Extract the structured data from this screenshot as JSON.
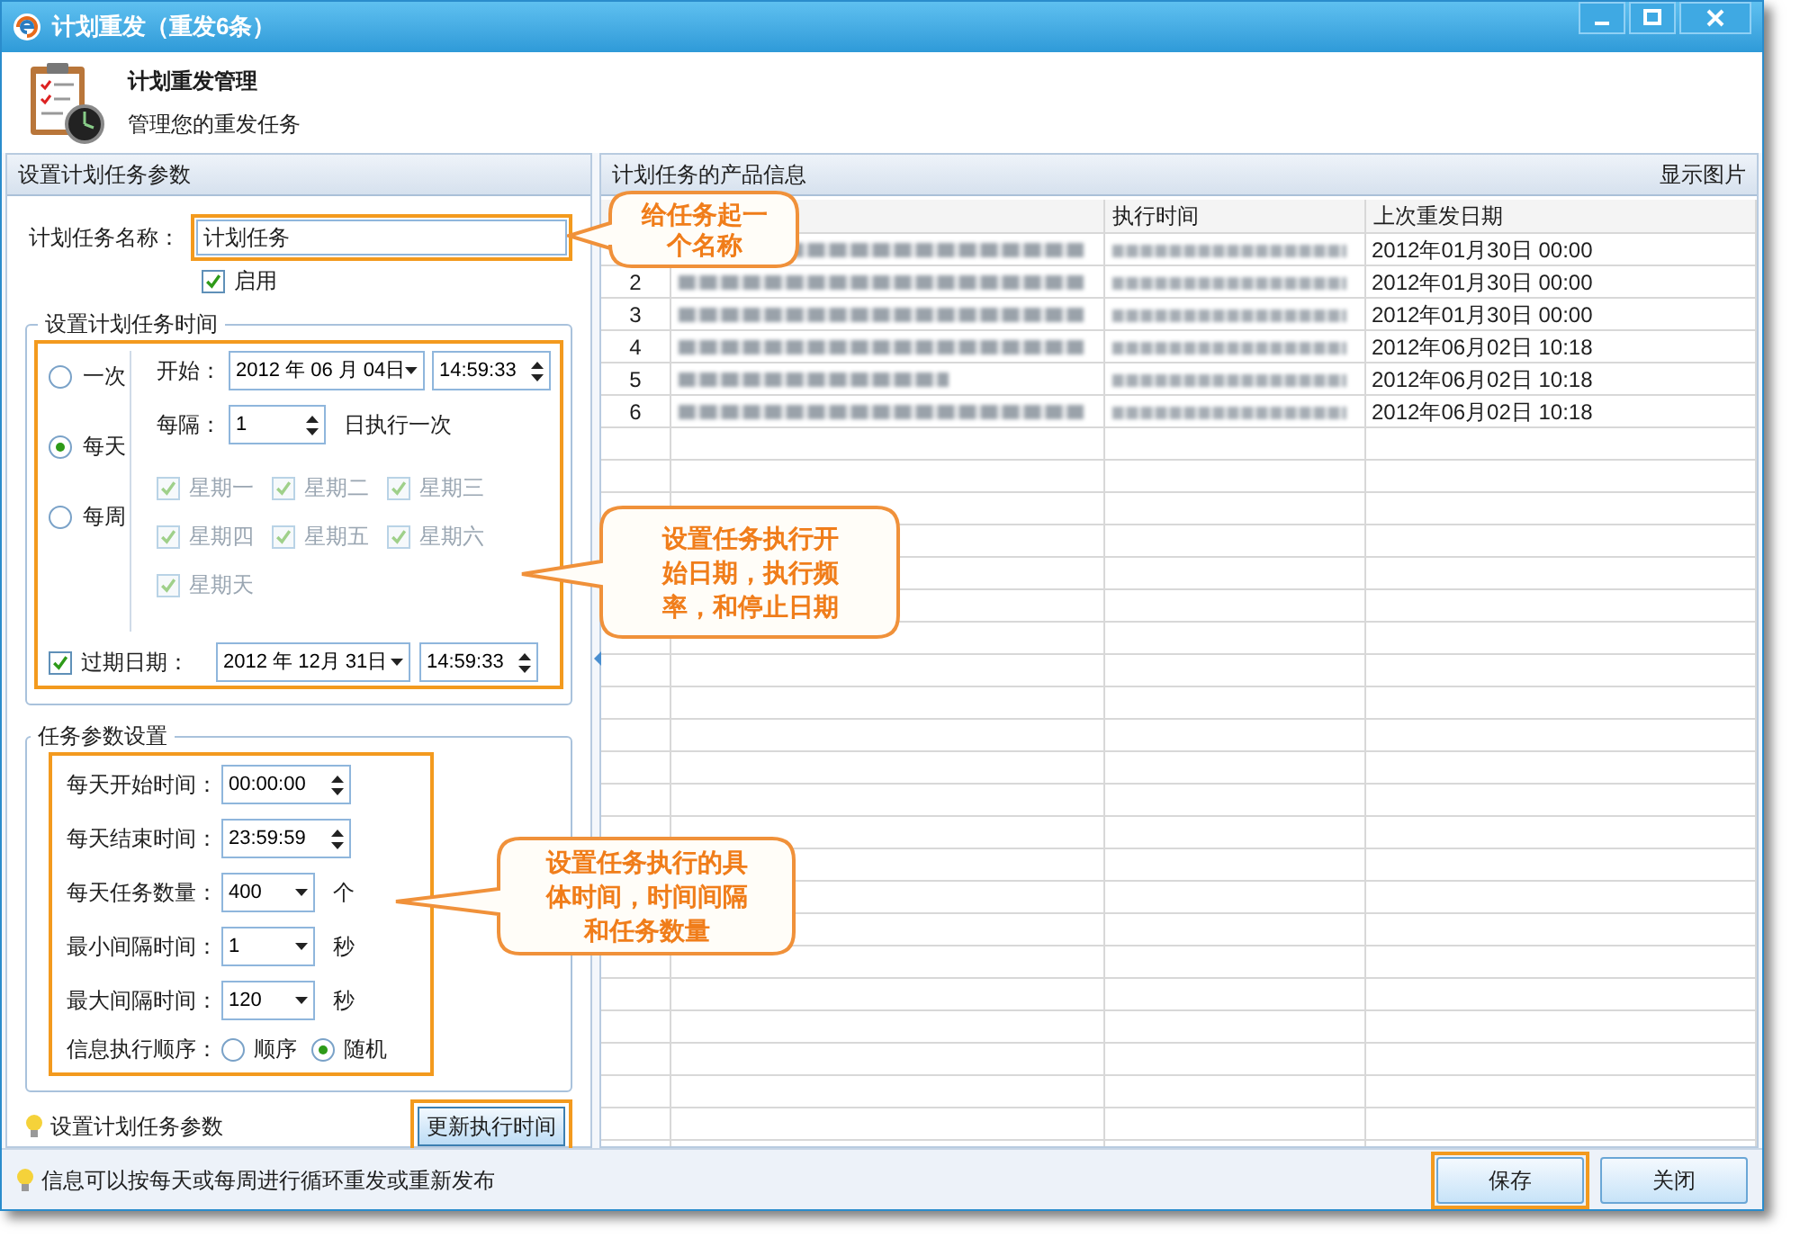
{
  "window": {
    "title": "计划重发（重发6条）"
  },
  "header": {
    "title": "计划重发管理",
    "subtitle": "管理您的重发任务"
  },
  "left_panel": {
    "title": "设置计划任务参数",
    "task_name": {
      "label": "计划任务名称：",
      "value": "计划任务"
    },
    "enable": {
      "label": "启用",
      "checked": true
    },
    "schedule": {
      "title": "设置计划任务时间",
      "modes": [
        {
          "label": "一次",
          "selected": false
        },
        {
          "label": "每天",
          "selected": true
        },
        {
          "label": "每周",
          "selected": false
        }
      ],
      "start": {
        "label": "开始：",
        "date": "2012 年 06 月 04日",
        "time": "14:59:33"
      },
      "interval": {
        "label": "每隔：",
        "value": "1",
        "suffix": "日执行一次"
      },
      "weekdays": [
        {
          "label": "星期一",
          "checked": true,
          "disabled": true
        },
        {
          "label": "星期二",
          "checked": true,
          "disabled": true
        },
        {
          "label": "星期三",
          "checked": true,
          "disabled": true
        },
        {
          "label": "星期四",
          "checked": true,
          "disabled": true
        },
        {
          "label": "星期五",
          "checked": true,
          "disabled": true
        },
        {
          "label": "星期六",
          "checked": true,
          "disabled": true
        },
        {
          "label": "星期天",
          "checked": true,
          "disabled": true
        }
      ],
      "expiry": {
        "label": "过期日期：",
        "checked": true,
        "date": "2012 年 12月 31日",
        "time": "14:59:33"
      }
    },
    "params": {
      "title": "任务参数设置",
      "rows": [
        {
          "kind": "spin",
          "label": "每天开始时间：",
          "value": "00:00:00"
        },
        {
          "kind": "spin",
          "label": "每天结束时间：",
          "value": "23:59:59"
        },
        {
          "kind": "combo",
          "label": "每天任务数量：",
          "value": "400",
          "unit": "个"
        },
        {
          "kind": "combo",
          "label": "最小间隔时间：",
          "value": "1",
          "unit": "秒"
        },
        {
          "kind": "combo",
          "label": "最大间隔时间：",
          "value": "120",
          "unit": "秒"
        }
      ],
      "order": {
        "label": "信息执行顺序：",
        "options": [
          {
            "label": "顺序",
            "selected": false
          },
          {
            "label": "随机",
            "selected": true
          }
        ]
      }
    },
    "hint": "设置计划任务参数",
    "update_button": "更新执行时间"
  },
  "right_panel": {
    "title": "计划任务的产品信息",
    "show_images": "显示图片",
    "table": {
      "columns": [
        "执行时间",
        "上次重发日期"
      ],
      "rows": [
        {
          "last_date": "2012年01月30日 00:00"
        },
        {
          "number": "2",
          "last_date": "2012年01月30日 00:00"
        },
        {
          "number": "3",
          "last_date": "2012年01月30日 00:00"
        },
        {
          "number": "4",
          "last_date": "2012年06月02日 10:18"
        },
        {
          "number": "5",
          "last_date": "2012年06月02日 10:18"
        },
        {
          "number": "6",
          "last_date": "2012年06月02日 10:18"
        }
      ]
    }
  },
  "status_bar": {
    "hint": "信息可以按每天或每周进行循环重发或重新发布"
  },
  "buttons": [
    "保存",
    "关闭"
  ],
  "callouts": [
    {
      "text": "给任务起一个名称"
    },
    {
      "text": "设置任务执行开始日期，执行频率，和停止日期"
    },
    {
      "text": "设置任务执行的具体时间，时间间隔和任务数量"
    }
  ]
}
